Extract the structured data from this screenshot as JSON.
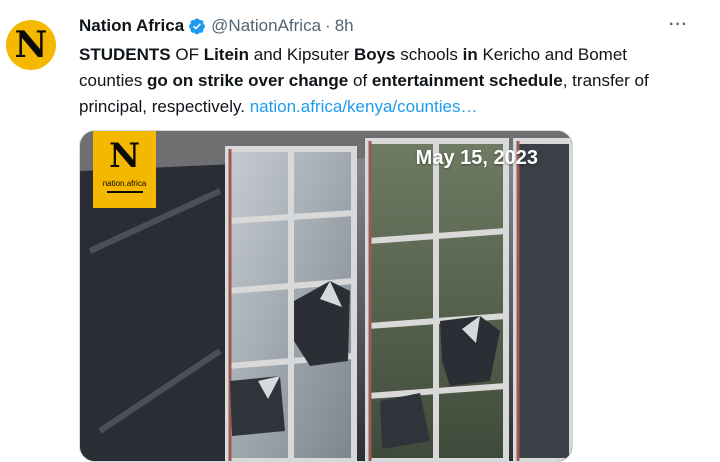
{
  "tweet": {
    "avatar_letter": "N",
    "name": "Nation Africa",
    "handle": "@NationAfrica",
    "separator": "·",
    "time": "8h",
    "more": "···",
    "text_segments": [
      {
        "t": "STUDENTS",
        "b": true
      },
      {
        "t": " OF ",
        "b": false
      },
      {
        "t": "Litein",
        "b": true
      },
      {
        "t": " and Kipsuter ",
        "b": false
      },
      {
        "t": "Boys",
        "b": true
      },
      {
        "t": " schools ",
        "b": false
      },
      {
        "t": "in",
        "b": true
      },
      {
        "t": " Kericho and Bomet counties ",
        "b": false
      },
      {
        "t": "go on strike over change",
        "b": true
      },
      {
        "t": " of ",
        "b": false
      },
      {
        "t": "entertainment schedule",
        "b": true
      },
      {
        "t": ", transfer of principal, respectively. ",
        "b": false
      }
    ],
    "link": "nation.africa/kenya/counties…"
  },
  "media": {
    "brand_letter": "N",
    "brand_wordmark": "nation.africa",
    "date_overlay": "May 15, 2023"
  },
  "colors": {
    "brand_yellow": "#f5b800",
    "link_blue": "#1d9bf0",
    "verified_blue": "#1d9bf0",
    "secondary_text": "#536471"
  }
}
